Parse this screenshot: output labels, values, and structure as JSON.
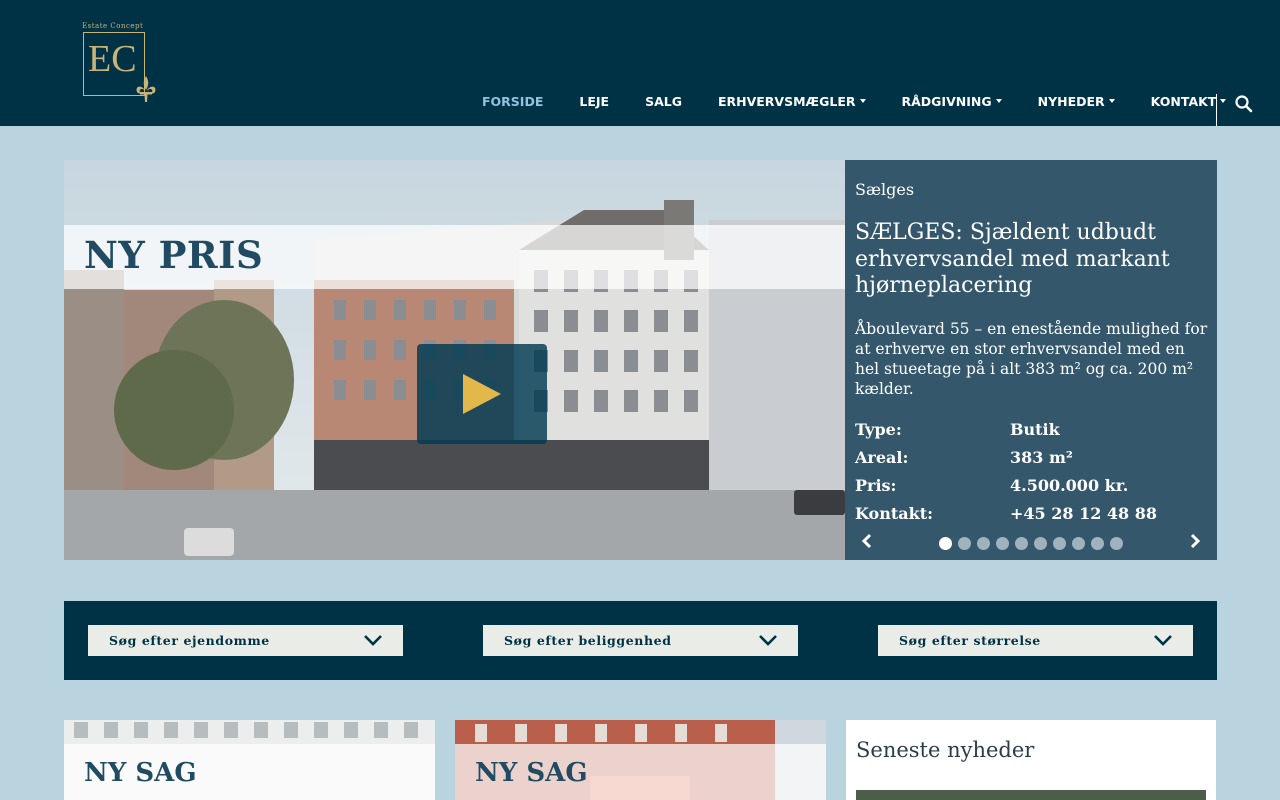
{
  "brand": {
    "tagline": "Estate Concept",
    "letters": "EC"
  },
  "nav": {
    "items": [
      {
        "label": "FORSIDE",
        "active": true,
        "dropdown": false
      },
      {
        "label": "LEJE",
        "active": false,
        "dropdown": false
      },
      {
        "label": "SALG",
        "active": false,
        "dropdown": false
      },
      {
        "label": "ERHVERVSMÆGLER",
        "active": false,
        "dropdown": true
      },
      {
        "label": "RÅDGIVNING",
        "active": false,
        "dropdown": true
      },
      {
        "label": "NYHEDER",
        "active": false,
        "dropdown": true
      },
      {
        "label": "KONTAKT",
        "active": false,
        "dropdown": true
      }
    ],
    "search_icon": "search-icon"
  },
  "hero": {
    "banner": "NY PRIS",
    "category": "Sælges",
    "title": "SÆLGES: Sjældent udbudt erhvervsandel med markant hjørneplacering",
    "description": "Åboulevard 55 – en enestående mulighed for at erhverve en stor erhvervsandel med en hel stueetage på i alt 383 m² og ca. 200 m² kælder.",
    "facts": [
      {
        "label": "Type:",
        "value": "Butik"
      },
      {
        "label": "Areal:",
        "value": "383 m²"
      },
      {
        "label": "Pris:",
        "value": "4.500.000 kr."
      },
      {
        "label": "Kontakt:",
        "value": "+45 28 12 48 88"
      }
    ],
    "slides_total": 10,
    "slide_active": 1
  },
  "search": {
    "property": "Søg efter ejendomme",
    "location": "Søg efter beliggenhed",
    "size": "Søg efter størrelse"
  },
  "cards": [
    {
      "label": "NY SAG"
    },
    {
      "label": "NY SAG"
    }
  ],
  "news": {
    "title": "Seneste nyheder"
  },
  "colors": {
    "header_bg": "#003246",
    "page_bg": "#b9d3df",
    "accent_gold": "#c9b378",
    "nav_active": "#8fc3df",
    "play_icon": "#e3b84a"
  }
}
